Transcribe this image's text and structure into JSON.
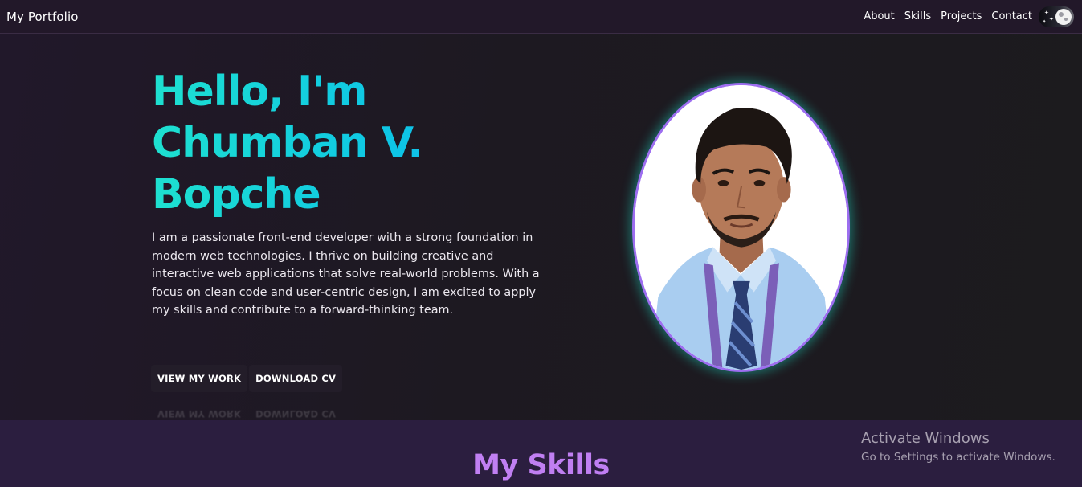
{
  "navbar": {
    "brand": "My Portfolio",
    "links": [
      "About",
      "Skills",
      "Projects",
      "Contact"
    ],
    "theme_toggle_icon": "moon-icon"
  },
  "hero": {
    "title_lines": [
      "Hello, I'm",
      "Chumban V.",
      "Bopche"
    ],
    "description": "I am a passionate front-end developer with a strong foundation in modern web technologies. I thrive on building creative and interactive web applications that solve real-world problems. With a focus on clean code and user-centric design, I am excited to apply my skills and contribute to a forward-thinking team.",
    "buttons": {
      "view_work": "VIEW MY WORK",
      "download_cv": "DOWNLOAD CV"
    },
    "colors": {
      "title_gradient_start": "#1ee0d0",
      "title_gradient_end": "#2aa3f0",
      "photo_border": "#9d6ef0"
    }
  },
  "skills": {
    "title": "My Skills",
    "title_color": "#c07ff2"
  },
  "watermark": {
    "title": "Activate Windows",
    "subtitle": "Go to Settings to activate Windows."
  }
}
